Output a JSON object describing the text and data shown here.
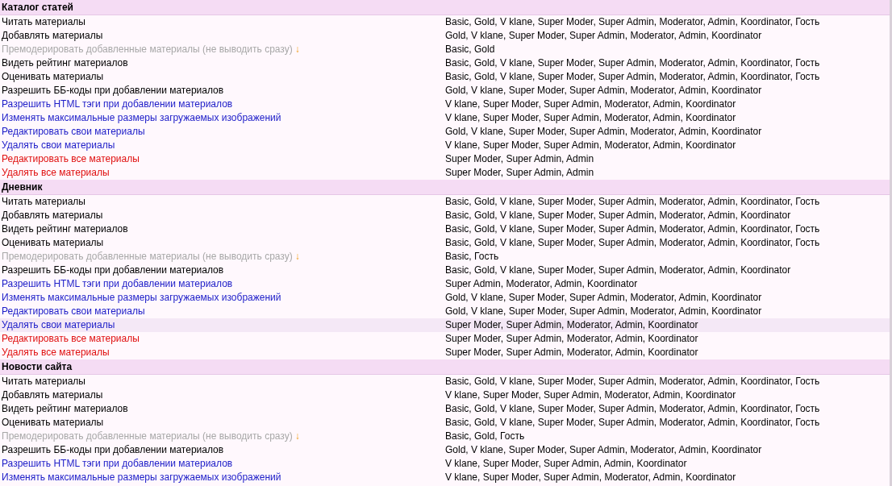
{
  "sections": [
    {
      "title": "Каталог статей",
      "rows": [
        {
          "kind": "normal",
          "highlighted": false,
          "label": "Читать материалы",
          "groups": "Basic, Gold, V klane, Super Moder, Super Admin, Moderator, Admin, Koordinator, Гость"
        },
        {
          "kind": "normal",
          "highlighted": false,
          "label": "Добавлять материалы",
          "groups": "Gold, V klane, Super Moder, Super Admin, Moderator, Admin, Koordinator"
        },
        {
          "kind": "muted",
          "highlighted": false,
          "label": "Премодерировать добавленные материалы (не выводить сразу)",
          "marker": "↓",
          "groups": "Basic, Gold"
        },
        {
          "kind": "normal",
          "highlighted": false,
          "label": "Видеть рейтинг материалов",
          "groups": "Basic, Gold, V klane, Super Moder, Super Admin, Moderator, Admin, Koordinator, Гость"
        },
        {
          "kind": "normal",
          "highlighted": false,
          "label": "Оценивать материалы",
          "groups": "Basic, Gold, V klane, Super Moder, Super Admin, Moderator, Admin, Koordinator, Гость"
        },
        {
          "kind": "normal",
          "highlighted": false,
          "label": "Разрешить ББ-коды при добавлении материалов",
          "groups": "Gold, V klane, Super Moder, Super Admin, Moderator, Admin, Koordinator"
        },
        {
          "kind": "link",
          "highlighted": false,
          "label": "Разрешить HTML тэги при добавлении материалов",
          "groups": "V klane, Super Moder, Super Admin, Moderator, Admin, Koordinator"
        },
        {
          "kind": "link",
          "highlighted": false,
          "label": "Изменять максимальные размеры загружаемых изображений",
          "groups": "V klane, Super Moder, Super Admin, Moderator, Admin, Koordinator"
        },
        {
          "kind": "link",
          "highlighted": false,
          "label": "Редактировать свои материалы",
          "groups": "Gold, V klane, Super Moder, Super Admin, Moderator, Admin, Koordinator"
        },
        {
          "kind": "link",
          "highlighted": false,
          "label": "Удалять свои материалы",
          "groups": "V klane, Super Moder, Super Admin, Moderator, Admin, Koordinator"
        },
        {
          "kind": "danger",
          "highlighted": false,
          "label": "Редактировать все материалы",
          "groups": "Super Moder, Super Admin, Admin"
        },
        {
          "kind": "danger",
          "highlighted": false,
          "label": "Удалять все материалы",
          "groups": "Super Moder, Super Admin, Admin"
        }
      ]
    },
    {
      "title": "Дневник",
      "rows": [
        {
          "kind": "normal",
          "highlighted": false,
          "label": "Читать материалы",
          "groups": "Basic, Gold, V klane, Super Moder, Super Admin, Moderator, Admin, Koordinator, Гость"
        },
        {
          "kind": "normal",
          "highlighted": false,
          "label": "Добавлять материалы",
          "groups": "Basic, Gold, V klane, Super Moder, Super Admin, Moderator, Admin, Koordinator"
        },
        {
          "kind": "normal",
          "highlighted": false,
          "label": "Видеть рейтинг материалов",
          "groups": "Basic, Gold, V klane, Super Moder, Super Admin, Moderator, Admin, Koordinator, Гость"
        },
        {
          "kind": "normal",
          "highlighted": false,
          "label": "Оценивать материалы",
          "groups": "Basic, Gold, V klane, Super Moder, Super Admin, Moderator, Admin, Koordinator, Гость"
        },
        {
          "kind": "muted",
          "highlighted": false,
          "label": "Премодерировать добавленные материалы (не выводить сразу)",
          "marker": "↓",
          "groups": "Basic, Гость"
        },
        {
          "kind": "normal",
          "highlighted": false,
          "label": "Разрешить ББ-коды при добавлении материалов",
          "groups": "Basic, Gold, V klane, Super Moder, Super Admin, Moderator, Admin, Koordinator"
        },
        {
          "kind": "link",
          "highlighted": false,
          "label": "Разрешить HTML тэги при добавлении материалов",
          "groups": "Super Admin, Moderator, Admin, Koordinator"
        },
        {
          "kind": "link",
          "highlighted": false,
          "label": "Изменять максимальные размеры загружаемых изображений",
          "groups": "Gold, V klane, Super Moder, Super Admin, Moderator, Admin, Koordinator"
        },
        {
          "kind": "link",
          "highlighted": false,
          "label": "Редактировать свои материалы",
          "groups": "Gold, V klane, Super Moder, Super Admin, Moderator, Admin, Koordinator"
        },
        {
          "kind": "link",
          "highlighted": true,
          "label": "Удалять свои материалы",
          "groups": "Super Moder, Super Admin, Moderator, Admin, Koordinator"
        },
        {
          "kind": "danger",
          "highlighted": false,
          "label": "Редактировать все материалы",
          "groups": "Super Moder, Super Admin, Moderator, Admin, Koordinator"
        },
        {
          "kind": "danger",
          "highlighted": false,
          "label": "Удалять все материалы",
          "groups": "Super Moder, Super Admin, Moderator, Admin, Koordinator"
        }
      ]
    },
    {
      "title": "Новости сайта",
      "rows": [
        {
          "kind": "normal",
          "highlighted": false,
          "label": "Читать материалы",
          "groups": "Basic, Gold, V klane, Super Moder, Super Admin, Moderator, Admin, Koordinator, Гость"
        },
        {
          "kind": "normal",
          "highlighted": false,
          "label": "Добавлять материалы",
          "groups": "V klane, Super Moder, Super Admin, Moderator, Admin, Koordinator"
        },
        {
          "kind": "normal",
          "highlighted": false,
          "label": "Видеть рейтинг материалов",
          "groups": "Basic, Gold, V klane, Super Moder, Super Admin, Moderator, Admin, Koordinator, Гость"
        },
        {
          "kind": "normal",
          "highlighted": false,
          "label": "Оценивать материалы",
          "groups": "Basic, Gold, V klane, Super Moder, Super Admin, Moderator, Admin, Koordinator, Гость"
        },
        {
          "kind": "muted",
          "highlighted": false,
          "label": "Премодерировать добавленные материалы (не выводить сразу)",
          "marker": "↓",
          "groups": "Basic, Gold, Гость"
        },
        {
          "kind": "normal",
          "highlighted": false,
          "label": "Разрешить ББ-коды при добавлении материалов",
          "groups": "Gold, V klane, Super Moder, Super Admin, Moderator, Admin, Koordinator"
        },
        {
          "kind": "link",
          "highlighted": false,
          "label": "Разрешить HTML тэги при добавлении материалов",
          "groups": "V klane, Super Moder, Super Admin, Admin, Koordinator"
        },
        {
          "kind": "link",
          "highlighted": false,
          "label": "Изменять максимальные размеры загружаемых изображений",
          "groups": "V klane, Super Moder, Super Admin, Moderator, Admin, Koordinator"
        }
      ]
    }
  ]
}
